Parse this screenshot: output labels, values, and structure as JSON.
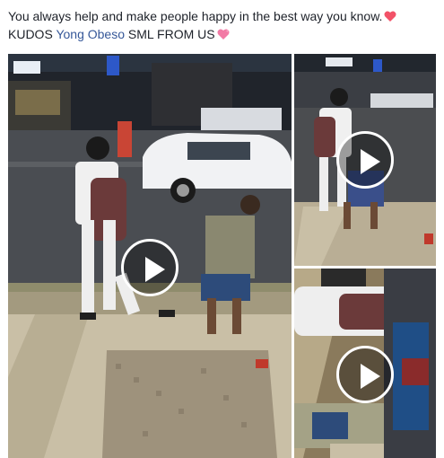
{
  "post": {
    "line1": "You always help and make people happy in the best way you know.",
    "line2_prefix": "KUDOS ",
    "mention": "Yong Obeso",
    "line2_suffix": " SML FROM US"
  },
  "icons": {
    "heart1": "red-heart-icon",
    "heart2": "sparkling-heart-icon",
    "play": "play-icon"
  },
  "colors": {
    "text": "#1d2129",
    "link": "#365899",
    "heart_red": "#f25268",
    "heart_pink": "#f27aa5"
  },
  "videos": [
    {
      "name": "main"
    },
    {
      "name": "top-right"
    },
    {
      "name": "bottom-right"
    }
  ]
}
